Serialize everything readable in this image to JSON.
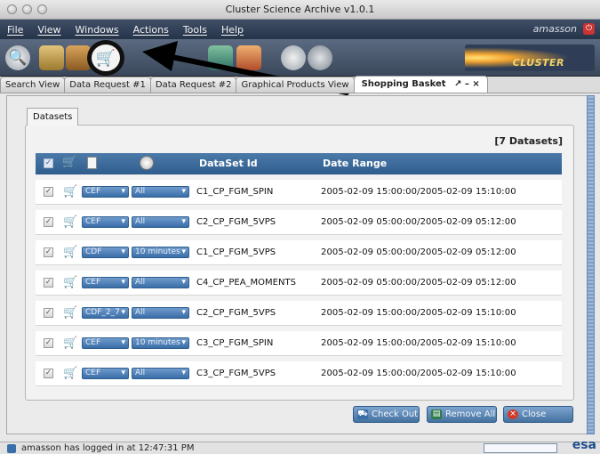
{
  "window": {
    "title": "Cluster Science Archive v1.0.1"
  },
  "menu": {
    "items": [
      "File",
      "View",
      "Windows",
      "Actions",
      "Tools",
      "Help"
    ],
    "user": "amasson"
  },
  "toolbar": {
    "icons": [
      "search-icon",
      "dataset-doc-icon",
      "data-request-icon",
      "shopping-cart-icon",
      "graph-icon",
      "bars-icon",
      "search-plus-icon",
      "search-minus-icon"
    ],
    "logo_text": "CLUSTER"
  },
  "tabs": [
    "Search View",
    "Data Request #1",
    "Data Request #2",
    "Graphical Products View",
    "Shopping Basket"
  ],
  "active_tab_controls": "↗ – ×",
  "datasets_tab": "Datasets",
  "dataset_count": "[7 Datasets]",
  "table": {
    "headers": {
      "dataset_id": "DataSet Id",
      "date_range": "Date Range"
    },
    "rows": [
      {
        "format": "CEF",
        "time": "All",
        "id": "C1_CP_FGM_SPIN",
        "range": "2005-02-09 15:00:00/2005-02-09 15:10:00"
      },
      {
        "format": "CEF",
        "time": "All",
        "id": "C2_CP_FGM_5VPS",
        "range": "2005-02-09 05:00:00/2005-02-09 05:12:00"
      },
      {
        "format": "CDF",
        "time": "10 minutes",
        "id": "C1_CP_FGM_5VPS",
        "range": "2005-02-09 05:00:00/2005-02-09 05:12:00"
      },
      {
        "format": "CEF",
        "time": "All",
        "id": "C4_CP_PEA_MOMENTS",
        "range": "2005-02-09 05:00:00/2005-02-09 05:12:00"
      },
      {
        "format": "CDF_2_7",
        "time": "All",
        "id": "C2_CP_FGM_5VPS",
        "range": "2005-02-09 15:00:00/2005-02-09 15:10:00"
      },
      {
        "format": "CEF",
        "time": "10 minutes",
        "id": "C3_CP_FGM_SPIN",
        "range": "2005-02-09 15:00:00/2005-02-09 15:10:00"
      },
      {
        "format": "CEF",
        "time": "All",
        "id": "C3_CP_FGM_5VPS",
        "range": "2005-02-09 15:00:00/2005-02-09 15:10:00"
      }
    ]
  },
  "buttons": {
    "checkout": "Check Out",
    "remove_all": "Remove All",
    "close": "Close"
  },
  "status": {
    "message": "amasson has logged in at 12:47:31 PM",
    "brand": "esa"
  },
  "colors": {
    "header_blue": "#2f5d8e",
    "menubar": "#26344a",
    "cart_red": "#c02020"
  }
}
